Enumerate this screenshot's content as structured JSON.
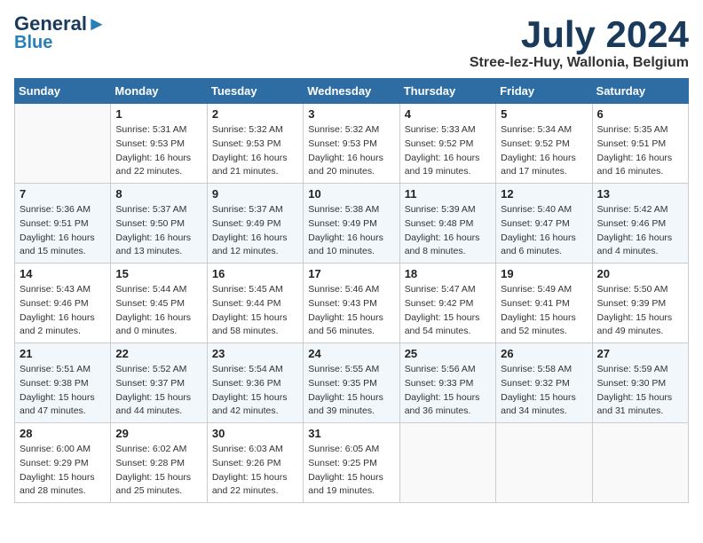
{
  "header": {
    "logo_line1": "General",
    "logo_line2": "Blue",
    "month_title": "July 2024",
    "location": "Stree-lez-Huy, Wallonia, Belgium"
  },
  "weekdays": [
    "Sunday",
    "Monday",
    "Tuesday",
    "Wednesday",
    "Thursday",
    "Friday",
    "Saturday"
  ],
  "weeks": [
    [
      {
        "day": "",
        "info": ""
      },
      {
        "day": "1",
        "info": "Sunrise: 5:31 AM\nSunset: 9:53 PM\nDaylight: 16 hours\nand 22 minutes."
      },
      {
        "day": "2",
        "info": "Sunrise: 5:32 AM\nSunset: 9:53 PM\nDaylight: 16 hours\nand 21 minutes."
      },
      {
        "day": "3",
        "info": "Sunrise: 5:32 AM\nSunset: 9:53 PM\nDaylight: 16 hours\nand 20 minutes."
      },
      {
        "day": "4",
        "info": "Sunrise: 5:33 AM\nSunset: 9:52 PM\nDaylight: 16 hours\nand 19 minutes."
      },
      {
        "day": "5",
        "info": "Sunrise: 5:34 AM\nSunset: 9:52 PM\nDaylight: 16 hours\nand 17 minutes."
      },
      {
        "day": "6",
        "info": "Sunrise: 5:35 AM\nSunset: 9:51 PM\nDaylight: 16 hours\nand 16 minutes."
      }
    ],
    [
      {
        "day": "7",
        "info": "Sunrise: 5:36 AM\nSunset: 9:51 PM\nDaylight: 16 hours\nand 15 minutes."
      },
      {
        "day": "8",
        "info": "Sunrise: 5:37 AM\nSunset: 9:50 PM\nDaylight: 16 hours\nand 13 minutes."
      },
      {
        "day": "9",
        "info": "Sunrise: 5:37 AM\nSunset: 9:49 PM\nDaylight: 16 hours\nand 12 minutes."
      },
      {
        "day": "10",
        "info": "Sunrise: 5:38 AM\nSunset: 9:49 PM\nDaylight: 16 hours\nand 10 minutes."
      },
      {
        "day": "11",
        "info": "Sunrise: 5:39 AM\nSunset: 9:48 PM\nDaylight: 16 hours\nand 8 minutes."
      },
      {
        "day": "12",
        "info": "Sunrise: 5:40 AM\nSunset: 9:47 PM\nDaylight: 16 hours\nand 6 minutes."
      },
      {
        "day": "13",
        "info": "Sunrise: 5:42 AM\nSunset: 9:46 PM\nDaylight: 16 hours\nand 4 minutes."
      }
    ],
    [
      {
        "day": "14",
        "info": "Sunrise: 5:43 AM\nSunset: 9:46 PM\nDaylight: 16 hours\nand 2 minutes."
      },
      {
        "day": "15",
        "info": "Sunrise: 5:44 AM\nSunset: 9:45 PM\nDaylight: 16 hours\nand 0 minutes."
      },
      {
        "day": "16",
        "info": "Sunrise: 5:45 AM\nSunset: 9:44 PM\nDaylight: 15 hours\nand 58 minutes."
      },
      {
        "day": "17",
        "info": "Sunrise: 5:46 AM\nSunset: 9:43 PM\nDaylight: 15 hours\nand 56 minutes."
      },
      {
        "day": "18",
        "info": "Sunrise: 5:47 AM\nSunset: 9:42 PM\nDaylight: 15 hours\nand 54 minutes."
      },
      {
        "day": "19",
        "info": "Sunrise: 5:49 AM\nSunset: 9:41 PM\nDaylight: 15 hours\nand 52 minutes."
      },
      {
        "day": "20",
        "info": "Sunrise: 5:50 AM\nSunset: 9:39 PM\nDaylight: 15 hours\nand 49 minutes."
      }
    ],
    [
      {
        "day": "21",
        "info": "Sunrise: 5:51 AM\nSunset: 9:38 PM\nDaylight: 15 hours\nand 47 minutes."
      },
      {
        "day": "22",
        "info": "Sunrise: 5:52 AM\nSunset: 9:37 PM\nDaylight: 15 hours\nand 44 minutes."
      },
      {
        "day": "23",
        "info": "Sunrise: 5:54 AM\nSunset: 9:36 PM\nDaylight: 15 hours\nand 42 minutes."
      },
      {
        "day": "24",
        "info": "Sunrise: 5:55 AM\nSunset: 9:35 PM\nDaylight: 15 hours\nand 39 minutes."
      },
      {
        "day": "25",
        "info": "Sunrise: 5:56 AM\nSunset: 9:33 PM\nDaylight: 15 hours\nand 36 minutes."
      },
      {
        "day": "26",
        "info": "Sunrise: 5:58 AM\nSunset: 9:32 PM\nDaylight: 15 hours\nand 34 minutes."
      },
      {
        "day": "27",
        "info": "Sunrise: 5:59 AM\nSunset: 9:30 PM\nDaylight: 15 hours\nand 31 minutes."
      }
    ],
    [
      {
        "day": "28",
        "info": "Sunrise: 6:00 AM\nSunset: 9:29 PM\nDaylight: 15 hours\nand 28 minutes."
      },
      {
        "day": "29",
        "info": "Sunrise: 6:02 AM\nSunset: 9:28 PM\nDaylight: 15 hours\nand 25 minutes."
      },
      {
        "day": "30",
        "info": "Sunrise: 6:03 AM\nSunset: 9:26 PM\nDaylight: 15 hours\nand 22 minutes."
      },
      {
        "day": "31",
        "info": "Sunrise: 6:05 AM\nSunset: 9:25 PM\nDaylight: 15 hours\nand 19 minutes."
      },
      {
        "day": "",
        "info": ""
      },
      {
        "day": "",
        "info": ""
      },
      {
        "day": "",
        "info": ""
      }
    ]
  ]
}
